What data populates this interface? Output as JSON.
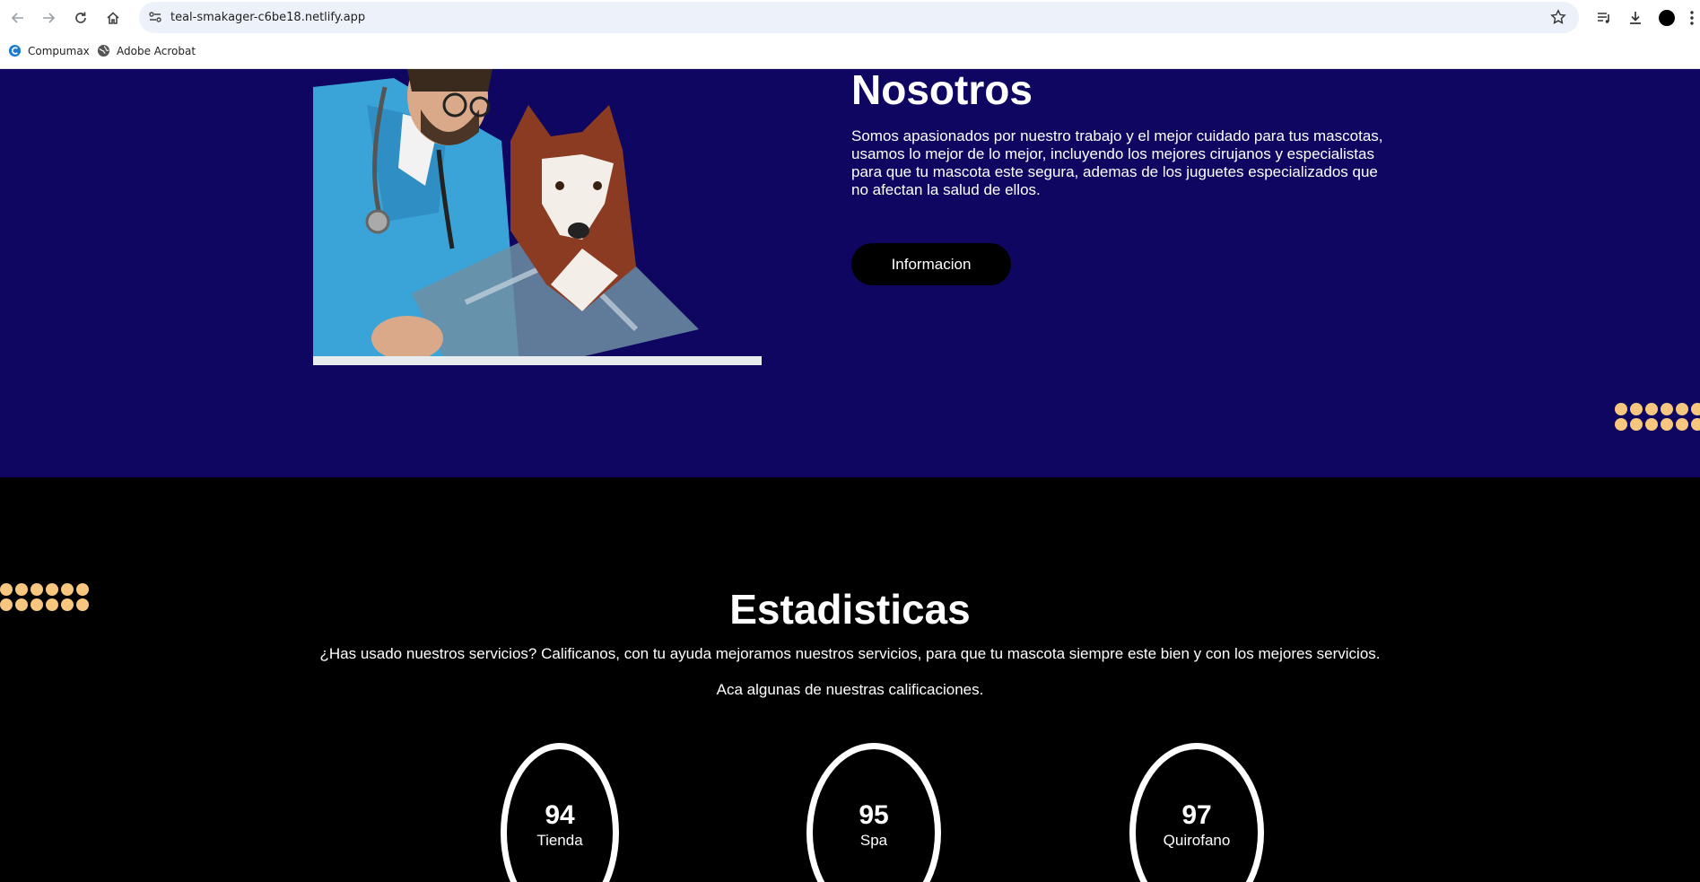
{
  "browser": {
    "url": "teal-smakager-c6be18.netlify.app",
    "bookmarks": [
      {
        "label": "Compumax",
        "icon": "compumax-icon"
      },
      {
        "label": "Adobe Acrobat",
        "icon": "globe-icon"
      }
    ]
  },
  "about": {
    "title": "Nosotros",
    "text": "Somos apasionados por nuestro trabajo y el mejor cuidado para tus mascotas, usamos lo mejor de lo mejor, incluyendo los mejores cirujanos y especialistas para que tu mascota este segura, ademas de los juguetes especializados que no afectan la salud de ellos.",
    "button_label": "Informacion"
  },
  "stats": {
    "title": "Estadisticas",
    "text": "¿Has usado nuestros servicios? Calificanos, con tu ayuda mejoramos nuestros servicios, para que tu mascota siempre este bien y con los mejores servicios.",
    "subtext": "Aca algunas de nuestras calificaciones.",
    "items": [
      {
        "value": "94",
        "label": "Tienda"
      },
      {
        "value": "95",
        "label": "Spa"
      },
      {
        "value": "97",
        "label": "Quirofano"
      }
    ]
  },
  "colors": {
    "about_bg": "#0e0660",
    "stats_bg": "#000000",
    "dot_accent": "#f7c77f"
  }
}
